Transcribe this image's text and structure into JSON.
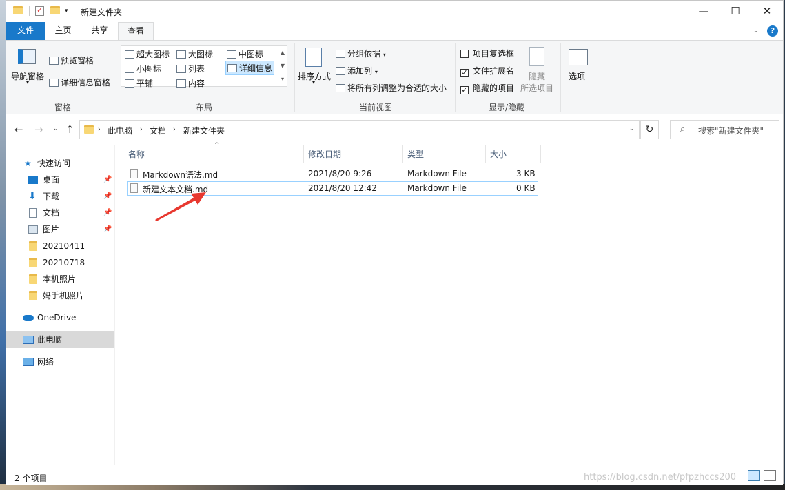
{
  "window": {
    "title": "新建文件夹",
    "controls": {
      "minimize": "—",
      "maximize": "☐",
      "close": "✕"
    }
  },
  "ribbon_tabs": [
    "文件",
    "主页",
    "共享",
    "查看"
  ],
  "ribbon": {
    "panes": {
      "nav_pane": "导航窗格",
      "preview_pane": "预览窗格",
      "details_pane": "详细信息窗格",
      "label": "窗格"
    },
    "layout": {
      "items": [
        "超大图标",
        "大图标",
        "中图标",
        "小图标",
        "列表",
        "详细信息",
        "平铺",
        "内容"
      ],
      "selected": "详细信息",
      "label": "布局"
    },
    "current_view": {
      "sort_by": "排序方式",
      "group_by": "分组依据",
      "add_column": "添加列",
      "fit_columns": "将所有列调整为合适的大小",
      "label": "当前视图"
    },
    "show_hide": {
      "item_checkboxes": {
        "label": "项目复选框",
        "checked": false
      },
      "file_extensions": {
        "label": "文件扩展名",
        "checked": true
      },
      "hidden_items": {
        "label": "隐藏的项目",
        "checked": true
      },
      "hide_selected_line1": "隐藏",
      "hide_selected_line2": "所选项目",
      "label": "显示/隐藏"
    },
    "options": "选项"
  },
  "address": {
    "crumbs": [
      "此电脑",
      "文档",
      "新建文件夹"
    ],
    "search_placeholder": "搜索\"新建文件夹\""
  },
  "nav_pane": {
    "quick_access": "快速访问",
    "pinned": [
      "桌面",
      "下载",
      "文档",
      "图片"
    ],
    "folders": [
      "20210411",
      "20210718",
      "本机照片",
      "妈手机照片"
    ],
    "onedrive": "OneDrive",
    "this_pc": "此电脑",
    "network": "网络"
  },
  "columns": [
    "名称",
    "修改日期",
    "类型",
    "大小"
  ],
  "files": [
    {
      "name": "Markdown语法.md",
      "modified": "2021/8/20 9:26",
      "type": "Markdown File",
      "size": "3 KB"
    },
    {
      "name": "新建文本文档.md",
      "modified": "2021/8/20 12:42",
      "type": "Markdown File",
      "size": "0 KB"
    }
  ],
  "status": {
    "count": "2 个项目",
    "watermark": "https://blog.csdn.net/pfpzhccs200"
  },
  "colors": {
    "accent": "#1979ca",
    "selection": "#cce8ff",
    "arrow": "#e8382f"
  }
}
